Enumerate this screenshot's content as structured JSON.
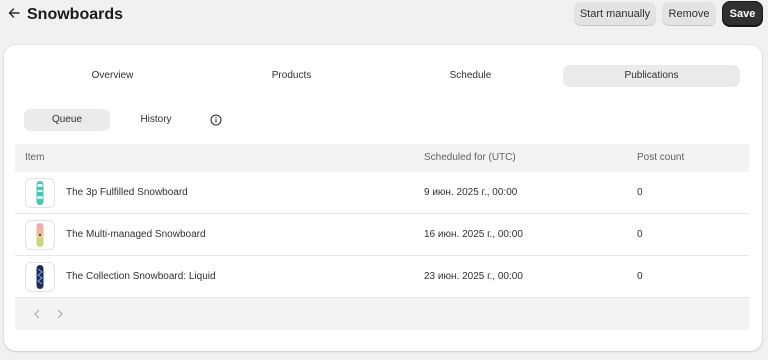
{
  "header": {
    "title": "Snowboards",
    "back_icon": "arrow-left-icon",
    "buttons": {
      "start": "Start manually",
      "remove": "Remove",
      "save": "Save"
    }
  },
  "tabs": [
    {
      "label": "Overview",
      "active": false
    },
    {
      "label": "Products",
      "active": false
    },
    {
      "label": "Schedule",
      "active": false
    },
    {
      "label": "Publications",
      "active": true
    }
  ],
  "subtabs": [
    {
      "label": "Queue",
      "active": true
    },
    {
      "label": "History",
      "active": false
    }
  ],
  "info_icon": "info-circle-icon",
  "table": {
    "headers": {
      "item": "Item",
      "scheduled": "Scheduled for (UTC)",
      "count": "Post count"
    },
    "rows": [
      {
        "name": "The 3p Fulfilled Snowboard",
        "scheduled": "9 июн. 2025 г., 00:00",
        "count": "0",
        "thumb": "snowboard-teal"
      },
      {
        "name": "The Multi-managed Snowboard",
        "scheduled": "16 июн. 2025 г., 00:00",
        "count": "0",
        "thumb": "snowboard-gradient"
      },
      {
        "name": "The Collection Snowboard: Liquid",
        "scheduled": "23 июн. 2025 г., 00:00",
        "count": "0",
        "thumb": "snowboard-navy"
      }
    ]
  },
  "pagination": {
    "prev_icon": "chevron-left-icon",
    "next_icon": "chevron-right-icon"
  },
  "colors": {
    "background": "#f1f1f1",
    "card": "#ffffff",
    "primary_button": "#303030",
    "secondary_button": "#e3e3e3",
    "active_tab": "#ebebeb"
  }
}
